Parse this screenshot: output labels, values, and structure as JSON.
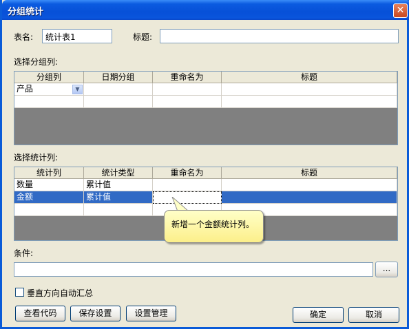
{
  "window": {
    "title": "分组统计",
    "close_symbol": "✕"
  },
  "table_name": {
    "label": "表名:",
    "value": "统计表1"
  },
  "caption": {
    "label": "标题:",
    "value": ""
  },
  "group_section": {
    "label": "选择分组列:",
    "headers": [
      "分组列",
      "日期分组",
      "重命名为",
      "标题"
    ],
    "rows": [
      [
        "产品",
        "",
        "",
        ""
      ],
      [
        "",
        "",
        "",
        ""
      ]
    ]
  },
  "stat_section": {
    "label": "选择统计列:",
    "headers": [
      "统计列",
      "统计类型",
      "重命名为",
      "标题"
    ],
    "rows": [
      [
        "数量",
        "累计值",
        "",
        ""
      ],
      [
        "金额",
        "累计值",
        "",
        ""
      ],
      [
        "",
        "",
        "",
        ""
      ]
    ]
  },
  "tooltip": {
    "text": "新增一个金额统计列。"
  },
  "condition": {
    "label": "条件:",
    "value": "",
    "browse_label": "..."
  },
  "auto_sum": {
    "label": "垂直方向自动汇总",
    "checked": false
  },
  "buttons": {
    "view_code": "查看代码",
    "save_settings": "保存设置",
    "manage_settings": "设置管理",
    "ok": "确定",
    "cancel": "取消"
  },
  "colors": {
    "titlebar": "#0A55DC",
    "selection": "#316AC5",
    "tooltip": "#FFFFC8",
    "grid_empty": "#808080"
  }
}
